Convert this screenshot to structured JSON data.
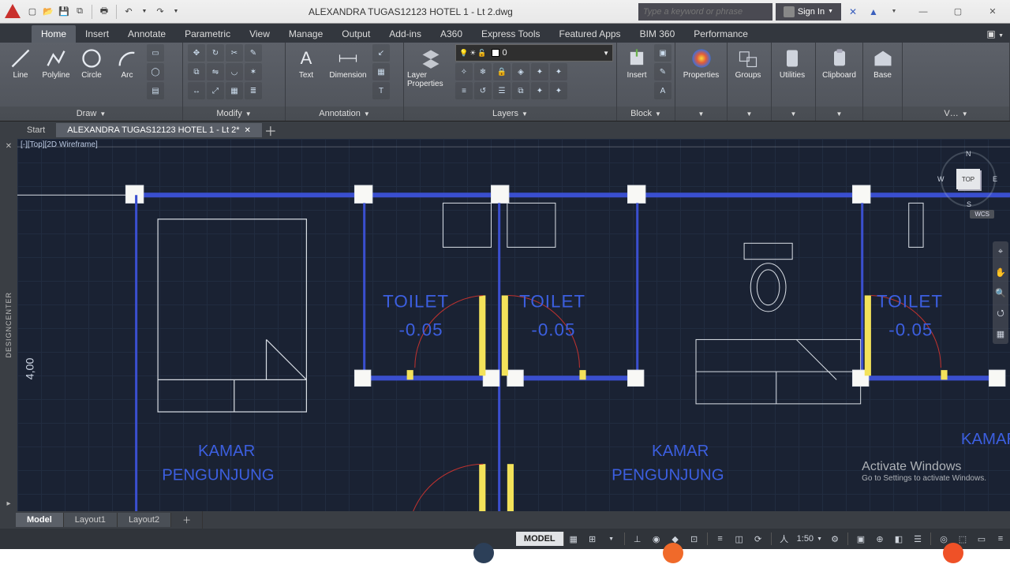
{
  "title": "ALEXANDRA TUGAS12123 HOTEL 1 - Lt  2.dwg",
  "search_placeholder": "Type a keyword or phrase",
  "signin_label": "Sign In",
  "ribbon_tabs": [
    "Home",
    "Insert",
    "Annotate",
    "Parametric",
    "View",
    "Manage",
    "Output",
    "Add-ins",
    "A360",
    "Express Tools",
    "Featured Apps",
    "BIM 360",
    "Performance"
  ],
  "ribbon_active": "Home",
  "panels": {
    "draw": {
      "label": "Draw",
      "items": [
        "Line",
        "Polyline",
        "Circle",
        "Arc"
      ]
    },
    "modify": {
      "label": "Modify"
    },
    "annotation": {
      "label": "Annotation",
      "items": [
        "Text",
        "Dimension"
      ]
    },
    "layers": {
      "label": "Layers",
      "big": "Layer Properties",
      "current": "0"
    },
    "block": {
      "label": "Block",
      "big": "Insert"
    },
    "properties": {
      "label": "Properties"
    },
    "groups": {
      "label": "Groups"
    },
    "utilities": {
      "label": "Utilities"
    },
    "clipboard": {
      "label": "Clipboard"
    },
    "base": {
      "label": "Base"
    },
    "view": {
      "label": "V…"
    }
  },
  "file_tabs": {
    "start": "Start",
    "doc": "ALEXANDRA TUGAS12123 HOTEL 1 - Lt  2*"
  },
  "viewport": {
    "label": "[-][Top][2D Wireframe]",
    "navcube_face": "TOP",
    "wcs": "WCS"
  },
  "drawing_text": {
    "toilet": "TOILET",
    "minus": "-0.05",
    "kamar": "KAMAR",
    "pengunjung": "PENGUNJUNG",
    "dim": "4,00"
  },
  "layout_tabs": [
    "Model",
    "Layout1",
    "Layout2"
  ],
  "status": {
    "model": "MODEL",
    "scale": "1:50"
  },
  "side_panel": "DESIGNCENTER",
  "activate": {
    "l1": "Activate Windows",
    "l2": "Go to Settings to activate Windows."
  }
}
